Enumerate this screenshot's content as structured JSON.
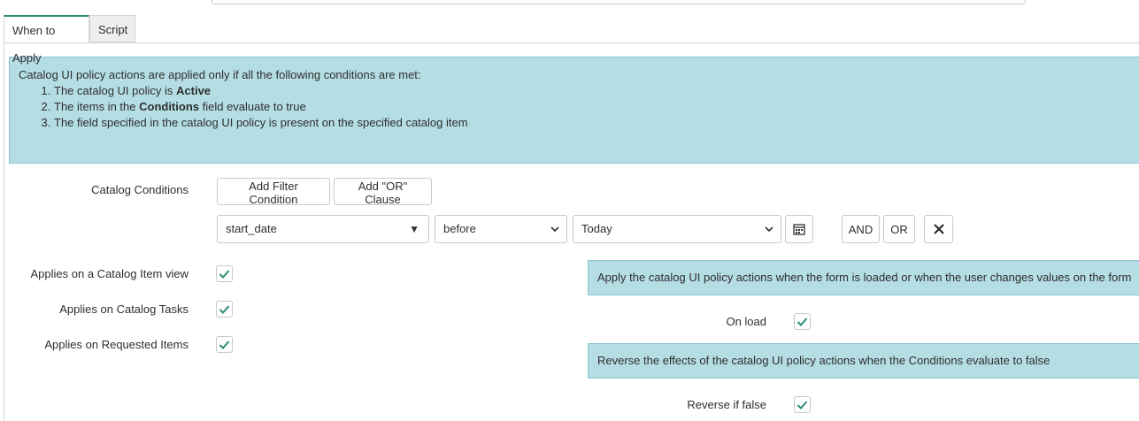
{
  "tabs": [
    {
      "label": "When to Apply",
      "active": true
    },
    {
      "label": "Script",
      "active": false
    }
  ],
  "info": {
    "intro": "Catalog UI policy actions are applied only if all the following conditions are met:",
    "items": [
      {
        "prefix": "The catalog UI policy is ",
        "bold": "Active",
        "suffix": ""
      },
      {
        "prefix": "The items in the ",
        "bold": "Conditions",
        "suffix": " field evaluate to true"
      },
      {
        "prefix": "The field specified in the catalog UI policy is present on the specified catalog item",
        "bold": "",
        "suffix": ""
      }
    ]
  },
  "conditions": {
    "label": "Catalog Conditions",
    "add_filter_label": "Add Filter Condition",
    "add_or_label": "Add \"OR\" Clause",
    "field_value": "start_date",
    "operator_value": "before",
    "date_value": "Today",
    "and_label": "AND",
    "or_label": "OR"
  },
  "applies": {
    "item_view_label": "Applies on a Catalog Item view",
    "item_view_checked": true,
    "tasks_label": "Applies on Catalog Tasks",
    "tasks_checked": true,
    "requested_label": "Applies on Requested Items",
    "requested_checked": true
  },
  "onload": {
    "info": "Apply the catalog UI policy actions when the form is loaded or when the user changes values on the form",
    "label": "On load",
    "checked": true
  },
  "reverse": {
    "info": "Reverse the effects of the catalog UI policy actions when the Conditions evaluate to false",
    "label": "Reverse if false",
    "checked": true
  },
  "colors": {
    "info_bg": "#b5dde4",
    "check": "#2e8b7a",
    "tab_accent": "#2e8b7a"
  }
}
